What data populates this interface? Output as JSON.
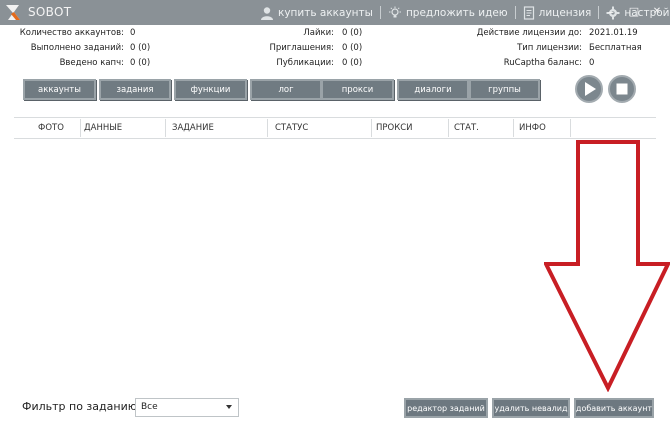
{
  "window": {
    "title": "SOBOT",
    "menu": [
      {
        "label": "купить аккаунты",
        "icon": "user-icon"
      },
      {
        "label": "предложить идею",
        "icon": "lightbulb-icon"
      },
      {
        "label": "лицензия",
        "icon": "document-icon"
      },
      {
        "label": "настройки",
        "icon": "gear-icon"
      }
    ],
    "minimize": "–",
    "maximize": "□",
    "close": "✕"
  },
  "stats": {
    "left": [
      {
        "label": "Количество аккаунтов:",
        "value": "0"
      },
      {
        "label": "Выполнено заданий:",
        "value": "0 (0)"
      },
      {
        "label": "Введено капч:",
        "value": "0 (0)"
      }
    ],
    "middle": [
      {
        "label": "Лайки:",
        "value": "0 (0)"
      },
      {
        "label": "Приглашения:",
        "value": "0 (0)"
      },
      {
        "label": "Публикации:",
        "value": "0 (0)"
      }
    ],
    "right": [
      {
        "label": "Действие лицензии до:",
        "value": "2021.01.19"
      },
      {
        "label": "Тип лицензии:",
        "value": "Бесплатная"
      },
      {
        "label": "RuCaptha баланс:",
        "value": "0"
      }
    ]
  },
  "tabs": [
    "аккаунты",
    "задания",
    "функции",
    "лог",
    "прокси",
    "диалоги",
    "группы"
  ],
  "controls": {
    "play": "play-icon",
    "stop": "stop-icon"
  },
  "table": {
    "columns": [
      "ФОТО",
      "ДАННЫЕ",
      "ЗАДАНИЕ",
      "СТАТУС",
      "ПРОКСИ",
      "СТАТ.",
      "ИНФО"
    ]
  },
  "filter": {
    "label": "Фильтр по заданию:",
    "selected": "Все"
  },
  "buttons": {
    "task_editor": "редактор заданий",
    "remove_invalid": "удалить невалид",
    "add_account": "добавить аккаунт"
  },
  "colors": {
    "titlebar": "#8a9196",
    "tab": "#707b82",
    "annotation_arrow": "#c81e24"
  }
}
